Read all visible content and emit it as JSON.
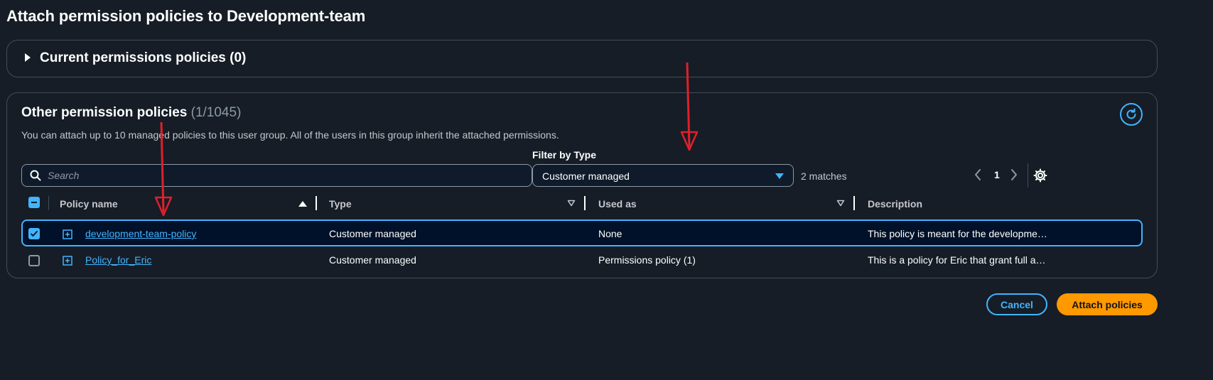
{
  "page": {
    "title": "Attach permission policies to Development-team"
  },
  "current_policies": {
    "heading": "Current permissions policies (0)"
  },
  "other_policies": {
    "heading": "Other permission policies",
    "count": "(1/1045)",
    "description": "You can attach up to 10 managed policies to this user group. All of the users in this group inherit the attached permissions.",
    "refresh_icon": "refresh-icon"
  },
  "filters": {
    "search_placeholder": "Search",
    "type_label": "Filter by Type",
    "type_value": "Customer managed",
    "matches": "2 matches"
  },
  "pagination": {
    "current_page": "1"
  },
  "table": {
    "columns": [
      "Policy name",
      "Type",
      "Used as",
      "Description"
    ],
    "rows": [
      {
        "selected": true,
        "name": "development-team-policy",
        "type": "Customer managed",
        "used_as": "None",
        "description": "This policy is meant for the developme…"
      },
      {
        "selected": false,
        "name": "Policy_for_Eric",
        "type": "Customer managed",
        "used_as": "Permissions policy (1)",
        "description": "This is a policy for Eric that grant full a…"
      }
    ]
  },
  "actions": {
    "cancel": "Cancel",
    "attach": "Attach policies"
  },
  "colors": {
    "background": "#161d26",
    "accent": "#42b4ff",
    "primary_button": "#ff9900",
    "annotation_arrow": "#e0202a"
  }
}
